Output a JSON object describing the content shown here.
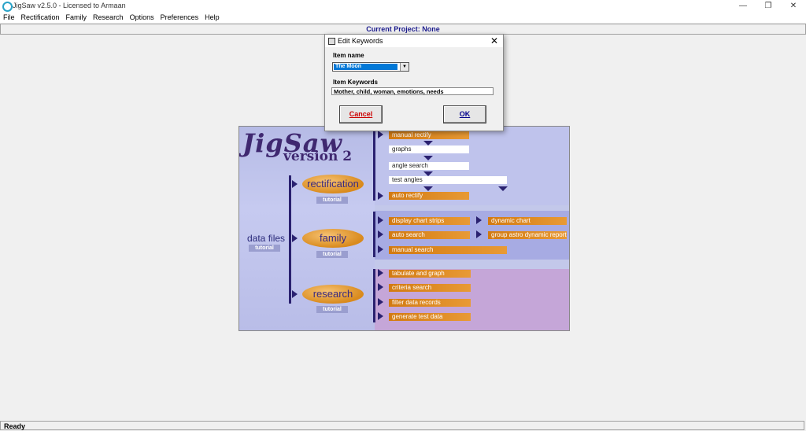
{
  "window": {
    "title": "JigSaw v2.5.0 - Licensed to Armaan",
    "controls": {
      "minimize": "—",
      "restore": "❐",
      "close": "✕"
    }
  },
  "menu": [
    "File",
    "Rectification",
    "Family",
    "Research",
    "Options",
    "Preferences",
    "Help"
  ],
  "project_bar": "Current Project: None",
  "status": "Ready",
  "splash": {
    "logo": "JigSaw",
    "version": "version 2",
    "data_files": "data files",
    "tutorial": "tutorial",
    "rectification": "rectification",
    "family": "family",
    "research": "research",
    "rect_items": [
      "manual rectify",
      "graphs",
      "angle search",
      "test angles",
      "auto rectify"
    ],
    "family_items": [
      "display chart strips",
      "dynamic chart",
      "auto search",
      "group astro dynamic report",
      "manual search"
    ],
    "research_items": [
      "tabulate and graph",
      "criteria search",
      "filter data records",
      "generate test data"
    ]
  },
  "dialog": {
    "title": "Edit Keywords",
    "item_name_label": "Item name",
    "item_name_value": "The Moon",
    "keywords_label": "Item Keywords",
    "keywords_value": "Mother, child, woman, emotions, needs",
    "cancel": "Cancel",
    "ok": "OK",
    "close": "✕"
  }
}
